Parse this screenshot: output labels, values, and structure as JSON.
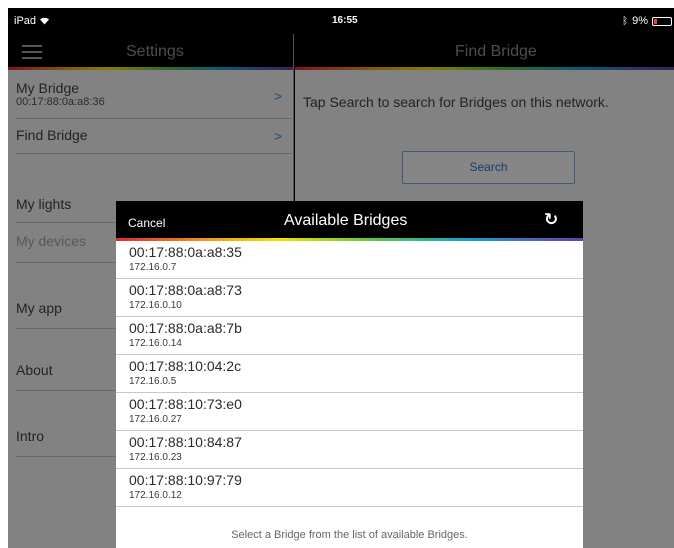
{
  "status_bar": {
    "device": "iPad",
    "wifi_icon": "wifi-icon",
    "time": "16:55",
    "bluetooth_icon": "bluetooth-icon",
    "battery": "9%"
  },
  "left_panel": {
    "title": "Settings",
    "menu_icon": "hamburger-menu-icon",
    "items": [
      {
        "label": "My Bridge",
        "sub": "00:17:88:0a:a8:36",
        "chevron": ">"
      },
      {
        "label": "Find Bridge",
        "chevron": ">"
      },
      {
        "label": "My lights",
        "chevron": ">"
      },
      {
        "label": "My devices"
      },
      {
        "label": "My app"
      },
      {
        "label": "About"
      },
      {
        "label": "Intro"
      }
    ]
  },
  "right_panel": {
    "title": "Find Bridge",
    "info": "Tap Search to search for Bridges on this network.",
    "search_label": "Search"
  },
  "modal": {
    "cancel_label": "Cancel",
    "title": "Available Bridges",
    "refresh_icon": "refresh-icon",
    "bridges": [
      {
        "mac": "00:17:88:0a:a8:35",
        "ip": "172.16.0.7"
      },
      {
        "mac": "00:17:88:0a:a8:73",
        "ip": "172.16.0.10"
      },
      {
        "mac": "00:17:88:0a:a8:7b",
        "ip": "172.16.0.14"
      },
      {
        "mac": "00:17:88:10:04:2c",
        "ip": "172.16.0.5"
      },
      {
        "mac": "00:17:88:10:73:e0",
        "ip": "172.16.0.27"
      },
      {
        "mac": "00:17:88:10:84:87",
        "ip": "172.16.0.23"
      },
      {
        "mac": "00:17:88:10:97:79",
        "ip": "172.16.0.12"
      }
    ],
    "footer": "Select a Bridge from the list of available Bridges."
  },
  "colors": {
    "accent": "#2c6ec5",
    "chevron": "#3d8fe0",
    "header_bg": "#000000",
    "panel_bg": "#ededed"
  }
}
